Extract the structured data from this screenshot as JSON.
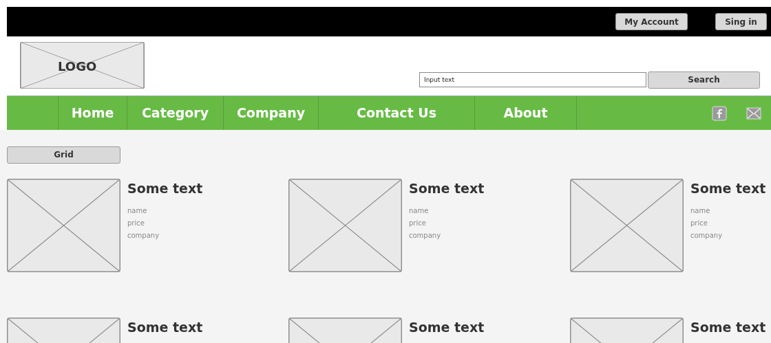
{
  "top_bar": {
    "buttons": [
      "My Account",
      "Sing in"
    ]
  },
  "header": {
    "logo": "LOGO",
    "search": {
      "value": "Input text",
      "button": "Search"
    }
  },
  "nav": {
    "items": [
      "Home",
      "Category",
      "Company",
      "Contact Us",
      "About"
    ]
  },
  "view_button": "Grid",
  "products": [
    {
      "title": "Some text",
      "details": [
        "name",
        "price",
        "company"
      ]
    },
    {
      "title": "Some text",
      "details": [
        "name",
        "price",
        "company"
      ]
    },
    {
      "title": "Some text",
      "details": [
        "name",
        "price",
        "company"
      ]
    },
    {
      "title": "Some text"
    },
    {
      "title": "Some text"
    },
    {
      "title": "Some text"
    }
  ]
}
